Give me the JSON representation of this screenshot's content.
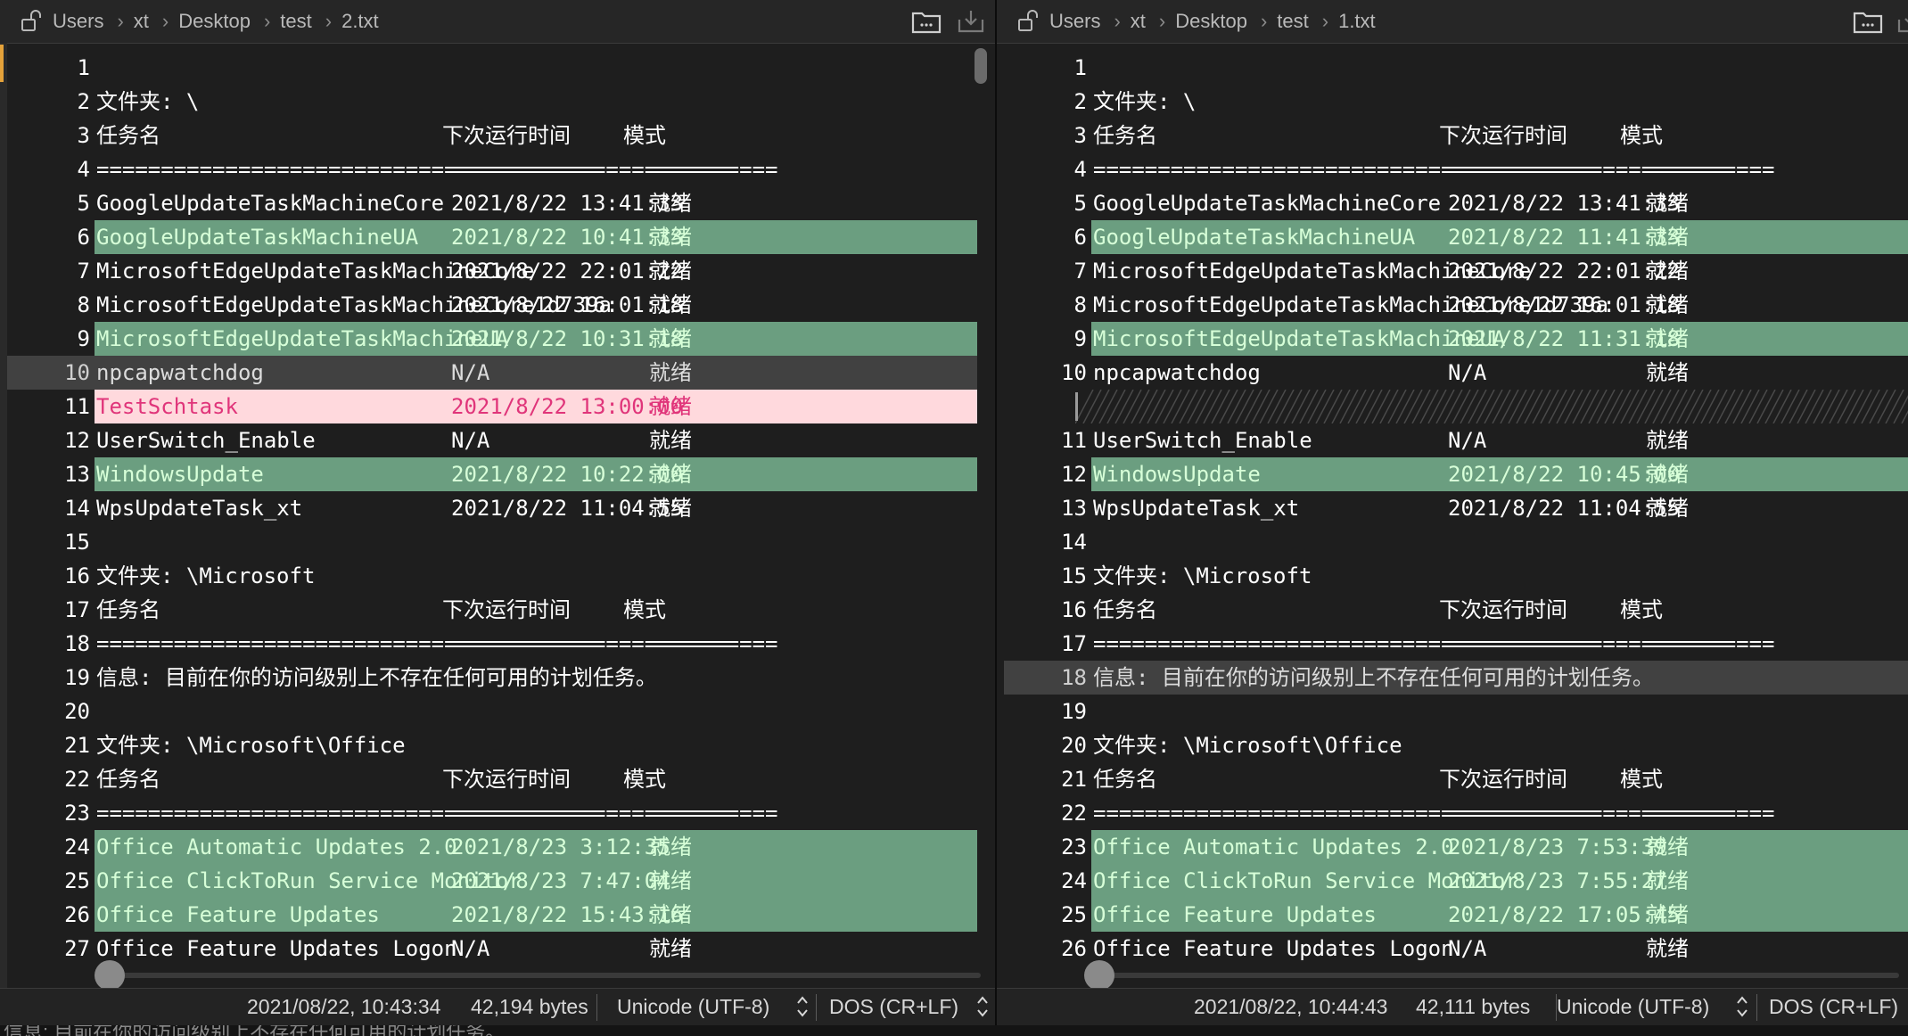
{
  "left": {
    "breadcrumb": [
      "Users",
      "xt",
      "Desktop",
      "test",
      "2.txt"
    ],
    "status": {
      "datetime": "2021/08/22, 10:43:34",
      "size": "42,194 bytes",
      "encoding": "Unicode (UTF-8)",
      "line_endings": "DOS (CR+LF)"
    },
    "lines": [
      {
        "n": "1",
        "c": [],
        "s": ""
      },
      {
        "n": "2",
        "c": [
          "文件夹: \\"
        ],
        "s": ""
      },
      {
        "n": "3",
        "c": [
          "任务名",
          "下次运行时间",
          "模式"
        ],
        "s": "h"
      },
      {
        "n": "4",
        "c": [
          "=======================================",
          "======================",
          "=========="
        ],
        "s": ""
      },
      {
        "n": "5",
        "c": [
          "GoogleUpdateTaskMachineCore",
          "2021/8/22 13:41:33",
          "就绪"
        ],
        "s": ""
      },
      {
        "n": "6",
        "c": [
          "GoogleUpdateTaskMachineUA",
          "2021/8/22 10:41:33",
          "就绪"
        ],
        "s": "changed"
      },
      {
        "n": "7",
        "c": [
          "MicrosoftEdgeUpdateTaskMachineCore",
          "2021/8/22 22:01:22",
          "就绪"
        ],
        "s": ""
      },
      {
        "n": "8",
        "c": [
          "MicrosoftEdgeUpdateTaskMachineCore1d739a",
          "2021/8/22 16:01:18",
          "就绪"
        ],
        "s": ""
      },
      {
        "n": "9",
        "c": [
          "MicrosoftEdgeUpdateTaskMachineUA",
          "2021/8/22 10:31:18",
          "就绪"
        ],
        "s": "changed"
      },
      {
        "n": "10",
        "c": [
          "npcapwatchdog",
          "N/A",
          "就绪"
        ],
        "s": "cur"
      },
      {
        "n": "11",
        "c": [
          "TestSchtask",
          "2021/8/22 13:00:00",
          "就绪"
        ],
        "s": "deleted"
      },
      {
        "n": "12",
        "c": [
          "UserSwitch_Enable",
          "N/A",
          "就绪"
        ],
        "s": ""
      },
      {
        "n": "13",
        "c": [
          "WindowsUpdate",
          "2021/8/22 10:22:00",
          "就绪"
        ],
        "s": "changed"
      },
      {
        "n": "14",
        "c": [
          "WpsUpdateTask_xt",
          "2021/8/22 11:04:55",
          "就绪"
        ],
        "s": ""
      },
      {
        "n": "15",
        "c": [],
        "s": ""
      },
      {
        "n": "16",
        "c": [
          "文件夹: \\Microsoft"
        ],
        "s": ""
      },
      {
        "n": "17",
        "c": [
          "任务名",
          "下次运行时间",
          "模式"
        ],
        "s": "h"
      },
      {
        "n": "18",
        "c": [
          "=======================================",
          "======================",
          "=========="
        ],
        "s": ""
      },
      {
        "n": "19",
        "c": [
          "信息: 目前在你的访问级别上不存在任何可用的计划任务。"
        ],
        "s": ""
      },
      {
        "n": "20",
        "c": [],
        "s": ""
      },
      {
        "n": "21",
        "c": [
          "文件夹: \\Microsoft\\Office"
        ],
        "s": ""
      },
      {
        "n": "22",
        "c": [
          "任务名",
          "下次运行时间",
          "模式"
        ],
        "s": "h"
      },
      {
        "n": "23",
        "c": [
          "=======================================",
          "======================",
          "=========="
        ],
        "s": ""
      },
      {
        "n": "24",
        "c": [
          "Office Automatic Updates 2.0",
          "2021/8/23 3:12:35",
          "就绪"
        ],
        "s": "changed"
      },
      {
        "n": "25",
        "c": [
          "Office ClickToRun Service Monitor",
          "2021/8/23 7:47:04",
          "就绪"
        ],
        "s": "changed"
      },
      {
        "n": "26",
        "c": [
          "Office Feature Updates",
          "2021/8/22 15:43:16",
          "就绪"
        ],
        "s": "changed"
      },
      {
        "n": "27",
        "c": [
          "Office Feature Updates Logon",
          "N/A",
          "就绪"
        ],
        "s": ""
      }
    ]
  },
  "right": {
    "breadcrumb": [
      "Users",
      "xt",
      "Desktop",
      "test",
      "1.txt"
    ],
    "status": {
      "datetime": "2021/08/22, 10:44:43",
      "size": "42,111 bytes",
      "encoding": "Unicode (UTF-8)",
      "line_endings": "DOS (CR+LF)"
    },
    "lines": [
      {
        "n": "1",
        "c": [],
        "s": ""
      },
      {
        "n": "2",
        "c": [
          "文件夹: \\"
        ],
        "s": ""
      },
      {
        "n": "3",
        "c": [
          "任务名",
          "下次运行时间",
          "模式"
        ],
        "s": "h"
      },
      {
        "n": "4",
        "c": [
          "=======================================",
          "======================",
          "=========="
        ],
        "s": ""
      },
      {
        "n": "5",
        "c": [
          "GoogleUpdateTaskMachineCore",
          "2021/8/22 13:41:33",
          "就绪"
        ],
        "s": ""
      },
      {
        "n": "6",
        "c": [
          "GoogleUpdateTaskMachineUA",
          "2021/8/22 11:41:33",
          "就绪"
        ],
        "s": "changed"
      },
      {
        "n": "7",
        "c": [
          "MicrosoftEdgeUpdateTaskMachineCore",
          "2021/8/22 22:01:22",
          "就绪"
        ],
        "s": ""
      },
      {
        "n": "8",
        "c": [
          "MicrosoftEdgeUpdateTaskMachineCore1d739a",
          "2021/8/22 16:01:18",
          "就绪"
        ],
        "s": ""
      },
      {
        "n": "9",
        "c": [
          "MicrosoftEdgeUpdateTaskMachineUA",
          "2021/8/22 11:31:18",
          "就绪"
        ],
        "s": "changed"
      },
      {
        "n": "10",
        "c": [
          "npcapwatchdog",
          "N/A",
          "就绪"
        ],
        "s": ""
      },
      {
        "n": "",
        "c": [],
        "s": "gap"
      },
      {
        "n": "11",
        "c": [
          "UserSwitch_Enable",
          "N/A",
          "就绪"
        ],
        "s": ""
      },
      {
        "n": "12",
        "c": [
          "WindowsUpdate",
          "2021/8/22 10:45:00",
          "就绪"
        ],
        "s": "changed"
      },
      {
        "n": "13",
        "c": [
          "WpsUpdateTask_xt",
          "2021/8/22 11:04:55",
          "就绪"
        ],
        "s": ""
      },
      {
        "n": "14",
        "c": [],
        "s": ""
      },
      {
        "n": "15",
        "c": [
          "文件夹: \\Microsoft"
        ],
        "s": ""
      },
      {
        "n": "16",
        "c": [
          "任务名",
          "下次运行时间",
          "模式"
        ],
        "s": "h"
      },
      {
        "n": "17",
        "c": [
          "=======================================",
          "======================",
          "=========="
        ],
        "s": ""
      },
      {
        "n": "18",
        "c": [
          "信息: 目前在你的访问级别上不存在任何可用的计划任务。"
        ],
        "s": "cur"
      },
      {
        "n": "19",
        "c": [],
        "s": ""
      },
      {
        "n": "20",
        "c": [
          "文件夹: \\Microsoft\\Office"
        ],
        "s": ""
      },
      {
        "n": "21",
        "c": [
          "任务名",
          "下次运行时间",
          "模式"
        ],
        "s": "h"
      },
      {
        "n": "22",
        "c": [
          "=======================================",
          "======================",
          "=========="
        ],
        "s": ""
      },
      {
        "n": "23",
        "c": [
          "Office Automatic Updates 2.0",
          "2021/8/23 7:53:39",
          "就绪"
        ],
        "s": "changed"
      },
      {
        "n": "24",
        "c": [
          "Office ClickToRun Service Monitor",
          "2021/8/23 7:55:27",
          "就绪"
        ],
        "s": "changed"
      },
      {
        "n": "25",
        "c": [
          "Office Feature Updates",
          "2021/8/22 17:05:45",
          "就绪"
        ],
        "s": "changed"
      },
      {
        "n": "26",
        "c": [
          "Office Feature Updates Logon",
          "N/A",
          "就绪"
        ],
        "s": ""
      }
    ]
  },
  "bottom_text": "信息: 目前在你的访问级别上不存在任何可用的计划任务。"
}
